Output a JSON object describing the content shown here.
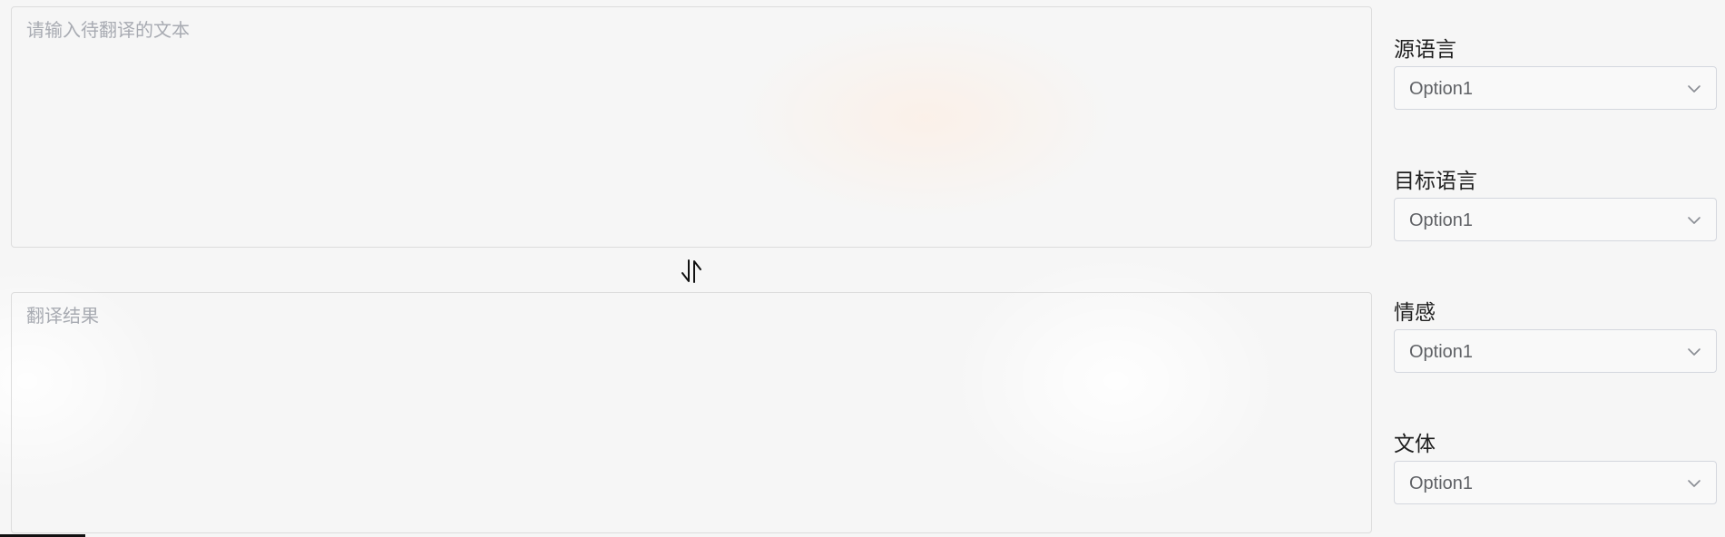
{
  "source_input": {
    "placeholder": "请输入待翻译的文本",
    "value": ""
  },
  "result_output": {
    "placeholder": "翻译结果",
    "value": ""
  },
  "swap": {
    "icon": "swap-vertical-icon"
  },
  "settings": {
    "source_language": {
      "label": "源语言",
      "selected": "Option1"
    },
    "target_language": {
      "label": "目标语言",
      "selected": "Option1"
    },
    "emotion": {
      "label": "情感",
      "selected": "Option1"
    },
    "style": {
      "label": "文体",
      "selected": "Option1"
    }
  },
  "colors": {
    "border": "#dcdcdc",
    "placeholder": "#a8abb2",
    "select_text": "#606266",
    "label_text": "#1f1f1f"
  }
}
